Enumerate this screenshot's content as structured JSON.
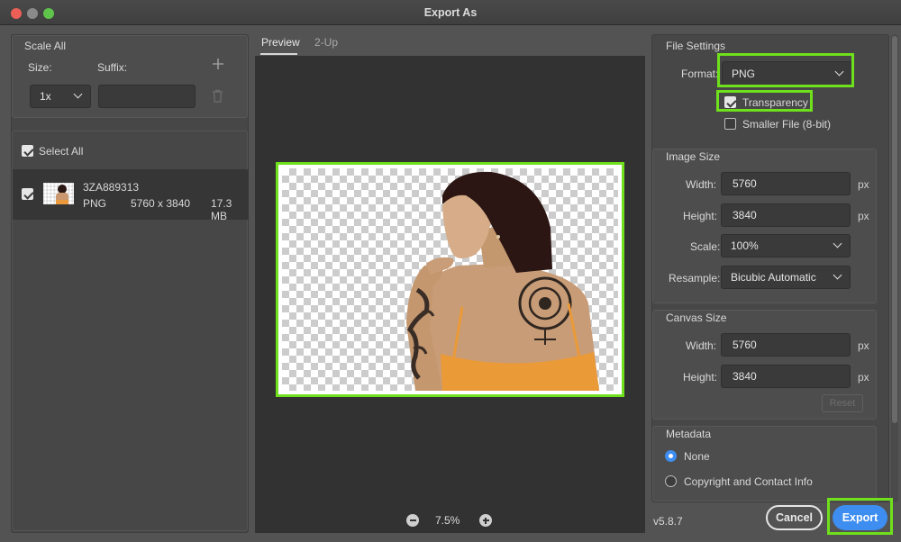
{
  "window": {
    "title": "Export As"
  },
  "left": {
    "scale_all": {
      "title": "Scale All",
      "size_label": "Size:",
      "suffix_label": "Suffix:",
      "size_value": "1x",
      "suffix_placeholder": ""
    },
    "select_all": {
      "label": "Select All",
      "checked": true
    },
    "asset": {
      "name": "3ZA889313",
      "format": "PNG",
      "dimensions": "5760 x 3840",
      "filesize": "17.3 MB",
      "checked": true
    }
  },
  "center": {
    "tabs": [
      {
        "label": "Preview",
        "active": true
      },
      {
        "label": "2-Up",
        "active": false
      }
    ],
    "zoom": "7.5%"
  },
  "right": {
    "file_settings": {
      "title": "File Settings",
      "format_label": "Format:",
      "format_value": "PNG",
      "transparency_label": "Transparency",
      "transparency_checked": true,
      "smaller_file_label": "Smaller File (8-bit)",
      "smaller_file_checked": false
    },
    "image_size": {
      "title": "Image Size",
      "width_label": "Width:",
      "width_value": "5760",
      "height_label": "Height:",
      "height_value": "3840",
      "unit": "px",
      "scale_label": "Scale:",
      "scale_value": "100%",
      "resample_label": "Resample:",
      "resample_value": "Bicubic Automatic"
    },
    "canvas_size": {
      "title": "Canvas Size",
      "width_label": "Width:",
      "width_value": "5760",
      "height_label": "Height:",
      "height_value": "3840",
      "unit": "px",
      "reset_label": "Reset"
    },
    "metadata": {
      "title": "Metadata",
      "options": [
        {
          "label": "None",
          "selected": true
        },
        {
          "label": "Copyright and Contact Info",
          "selected": false
        }
      ]
    }
  },
  "footer": {
    "version": "v5.8.7",
    "cancel_label": "Cancel",
    "export_label": "Export"
  },
  "colors": {
    "highlight": "#6fe01c",
    "accent": "#3d8ef0"
  }
}
